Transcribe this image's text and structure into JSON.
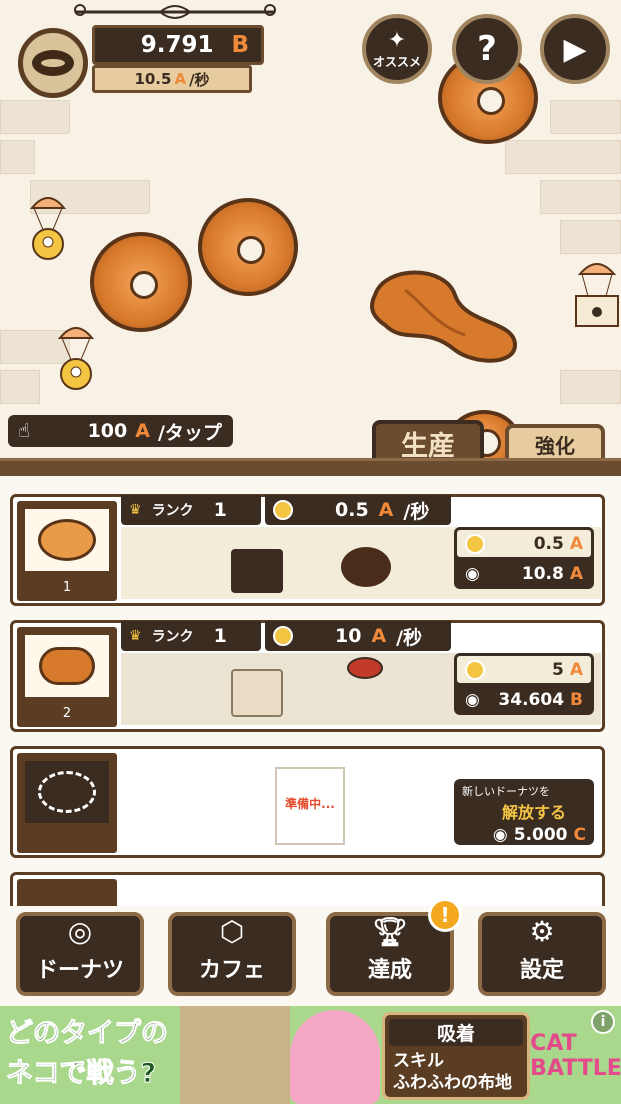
{
  "hud": {
    "currency_value": "9.791",
    "currency_unit": "B",
    "rate_value": "10.5",
    "rate_unit": "A",
    "rate_suffix": "/秒",
    "recommend_label": "オススメ",
    "help_label": "?",
    "play_label": "▶"
  },
  "tap": {
    "value": "100",
    "unit": "A",
    "suffix": "/タップ"
  },
  "tabs": {
    "production": "生産",
    "upgrade": "強化"
  },
  "lines": [
    {
      "number": "1",
      "rank_label": "ランク",
      "rank_value": "1",
      "speed_value": "0.5",
      "speed_unit": "A",
      "speed_suffix": "/秒",
      "info_rate_value": "0.5",
      "info_rate_unit": "A",
      "info_cost_value": "10.8",
      "info_cost_unit": "A"
    },
    {
      "number": "2",
      "rank_label": "ランク",
      "rank_value": "1",
      "speed_value": "10",
      "speed_unit": "A",
      "speed_suffix": "/秒",
      "info_rate_value": "5",
      "info_rate_unit": "A",
      "info_cost_value": "34.604",
      "info_cost_unit": "B"
    }
  ],
  "locked_line": {
    "sign_text": "準備中...",
    "unlock_prefix": "新しいドーナツを",
    "unlock_action": "解放する",
    "cost_value": "5.000",
    "cost_unit": "C"
  },
  "nav": {
    "donuts": "ドーナツ",
    "cafe": "カフェ",
    "achievements": "達成",
    "settings": "設定",
    "alert_badge": "!"
  },
  "ad": {
    "headline_line1": "どのタイプの",
    "headline_line2": "ネコで戦う?",
    "card_title": "吸着",
    "card_line1": "スキル",
    "card_line2": "ふわふわの布地",
    "logo": "CAT BATTLE",
    "info_icon": "i"
  },
  "colors": {
    "accent": "#f08a3a",
    "dark_panel": "#3b2c22",
    "wood": "#6b4c2f"
  }
}
